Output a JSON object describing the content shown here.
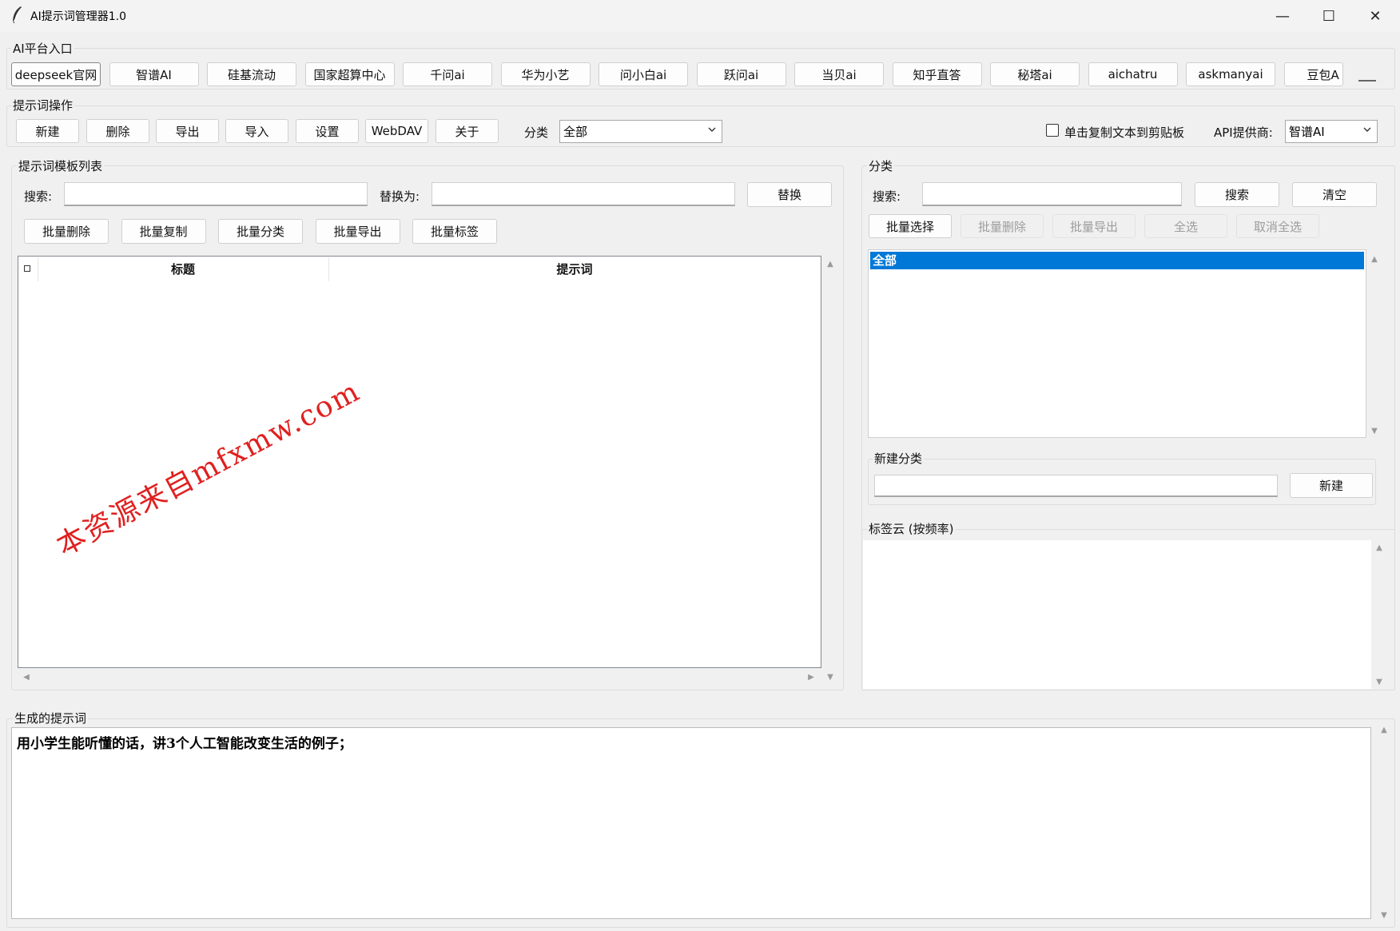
{
  "window": {
    "title": "AI提示词管理器1.0",
    "minimize": "—",
    "maximize": "☐",
    "close": "✕"
  },
  "platforms": {
    "legend": "AI平台入口",
    "items": [
      "deepseek官网",
      "智谱AI",
      "硅基流动",
      "国家超算中心",
      "千问ai",
      "华为小艺",
      "问小白ai",
      "跃问ai",
      "当贝ai",
      "知乎直答",
      "秘塔ai",
      "aichatru",
      "askmanyai",
      "豆包A"
    ]
  },
  "ops": {
    "legend": "提示词操作",
    "buttons": [
      "新建",
      "删除",
      "导出",
      "导入",
      "设置",
      "WebDAV",
      "关于"
    ],
    "category_label": "分类",
    "category_value": "全部",
    "copy_checkbox_label": "单击复制文本到剪贴板",
    "copy_checked": false,
    "api_label": "API提供商:",
    "api_value": "智谱AI"
  },
  "templates": {
    "legend": "提示词模板列表",
    "search_label": "搜索:",
    "search_value": "",
    "replace_label": "替换为:",
    "replace_value": "",
    "replace_button": "替换",
    "batch": [
      "批量删除",
      "批量复制",
      "批量分类",
      "批量导出",
      "批量标签"
    ],
    "columns": [
      "标题",
      "提示词"
    ],
    "rows": []
  },
  "category_panel": {
    "legend": "分类",
    "search_label": "搜索:",
    "search_value": "",
    "search_button": "搜索",
    "clear_button": "清空",
    "batch_select": "批量选择",
    "batch_delete": "批量删除",
    "batch_export": "批量导出",
    "select_all": "全选",
    "deselect_all": "取消全选",
    "items": [
      "全部"
    ],
    "selected_color": "#0078d7",
    "new_legend": "新建分类",
    "new_value": "",
    "new_button": "新建"
  },
  "tagcloud": {
    "legend": "标签云 (按频率)"
  },
  "generated": {
    "legend": "生成的提示词",
    "text": "用小学生能听懂的话，讲3个人工智能改变生活的例子；"
  },
  "watermark": "本资源来自mfxmw.com",
  "icons": {
    "app": "feather-icon",
    "dropdown": "chevron-down-icon",
    "scroll_up": "scroll-up-icon",
    "scroll_down": "scroll-down-icon"
  }
}
